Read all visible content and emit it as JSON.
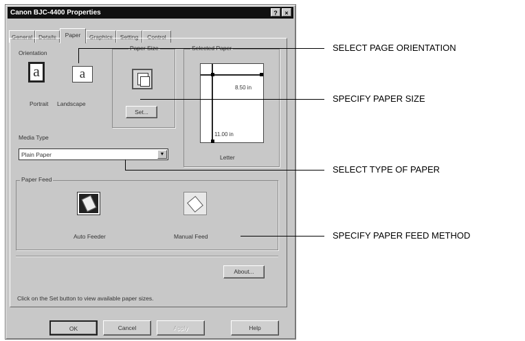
{
  "window": {
    "title": "Canon BJC-4400 Properties",
    "help_glyph": "?",
    "close_glyph": "×"
  },
  "tabs": [
    {
      "label": "General"
    },
    {
      "label": "Details"
    },
    {
      "label": "Paper",
      "active": true
    },
    {
      "label": "Graphics"
    },
    {
      "label": "Setting"
    },
    {
      "label": "Control"
    }
  ],
  "orientation": {
    "label": "Orientation",
    "portrait_label": "Portrait",
    "landscape_label": "Landscape",
    "icon_glyph": "a",
    "selected": "Portrait"
  },
  "paper_size": {
    "label": "Paper Size",
    "set_label": "Set..."
  },
  "selected_paper": {
    "label": "Selected Paper",
    "width": "8.50 in",
    "height": "11.00 in",
    "name": "Letter"
  },
  "media_type": {
    "label": "Media Type",
    "value": "Plain Paper"
  },
  "paper_feed": {
    "label": "Paper Feed",
    "auto_label": "Auto Feeder",
    "manual_label": "Manual Feed"
  },
  "about_label": "About...",
  "hint": "Click on the Set button to view available paper sizes.",
  "footer": {
    "ok": "OK",
    "cancel": "Cancel",
    "apply": "Apply",
    "help": "Help"
  },
  "annotations": [
    "SELECT PAGE ORIENTATION",
    "SPECIFY PAPER SIZE",
    "SELECT TYPE OF PAPER",
    "SPECIFY PAPER FEED METHOD"
  ]
}
